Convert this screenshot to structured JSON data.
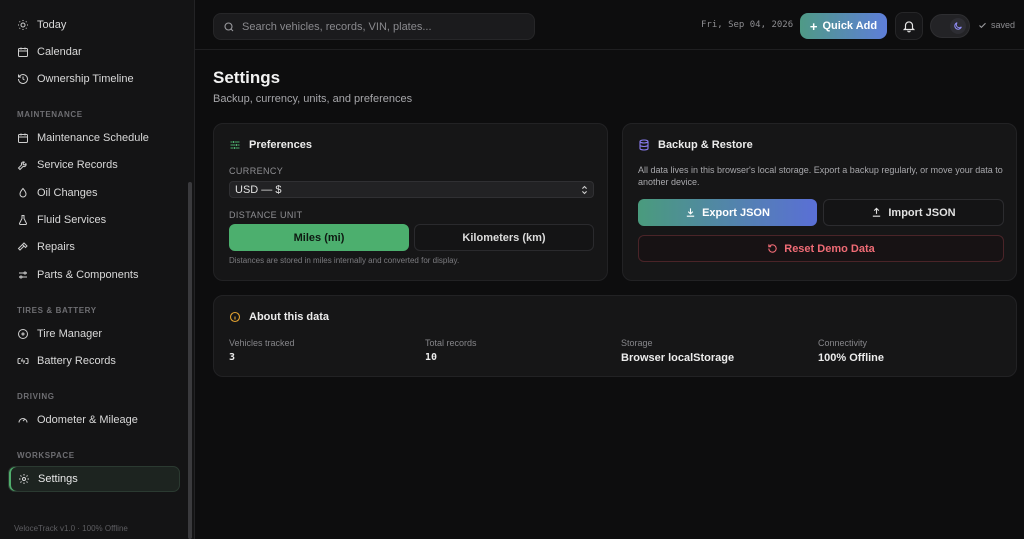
{
  "sidebar": {
    "items": [
      {
        "label": "Today",
        "icon": "sun-icon"
      },
      {
        "label": "Calendar",
        "icon": "calendar-icon"
      },
      {
        "label": "Ownership Timeline",
        "icon": "history-icon"
      }
    ],
    "sections": [
      {
        "label": "MAINTENANCE",
        "items": [
          {
            "label": "Maintenance Schedule",
            "icon": "calendar-icon"
          },
          {
            "label": "Service Records",
            "icon": "wrench-icon"
          },
          {
            "label": "Oil Changes",
            "icon": "droplet-icon"
          },
          {
            "label": "Fluid Services",
            "icon": "flask-icon"
          },
          {
            "label": "Repairs",
            "icon": "hammer-icon"
          },
          {
            "label": "Parts & Components",
            "icon": "sliders-icon"
          }
        ]
      },
      {
        "label": "TIRES & BATTERY",
        "items": [
          {
            "label": "Tire Manager",
            "icon": "tire-icon"
          },
          {
            "label": "Battery Records",
            "icon": "battery-icon"
          }
        ]
      },
      {
        "label": "DRIVING",
        "items": [
          {
            "label": "Odometer & Mileage",
            "icon": "gauge-icon"
          }
        ]
      },
      {
        "label": "WORKSPACE",
        "items": [
          {
            "label": "Settings",
            "icon": "gear-icon",
            "active": true
          }
        ]
      }
    ],
    "footer": "VeloceTrack v1.0 · 100% Offline"
  },
  "topbar": {
    "search_placeholder": "Search vehicles, records, VIN, plates...",
    "date": "Fri, Sep 04, 2026",
    "quick_add": "Quick Add",
    "saved": "saved"
  },
  "page": {
    "title": "Settings",
    "subtitle": "Backup, currency, units, and preferences"
  },
  "preferences": {
    "title": "Preferences",
    "currency_label": "CURRENCY",
    "currency_value": "USD — $",
    "distance_label": "DISTANCE UNIT",
    "miles": "Miles (mi)",
    "kilometers": "Kilometers (km)",
    "hint": "Distances are stored in miles internally and converted for display."
  },
  "backup": {
    "title": "Backup & Restore",
    "description": "All data lives in this browser's local storage. Export a backup regularly, or move your data to another device.",
    "export": "Export JSON",
    "import": "Import JSON",
    "reset": "Reset Demo Data"
  },
  "about": {
    "title": "About this data",
    "stats": [
      {
        "label": "Vehicles tracked",
        "value": "3"
      },
      {
        "label": "Total records",
        "value": "10"
      },
      {
        "label": "Storage",
        "value": "Browser localStorage"
      },
      {
        "label": "Connectivity",
        "value": "100% Offline"
      }
    ]
  },
  "colors": {
    "accent_green": "#4caf6e",
    "accent_blue": "#5a6fd6",
    "danger": "#ef6b75",
    "warning": "#e0a030"
  }
}
